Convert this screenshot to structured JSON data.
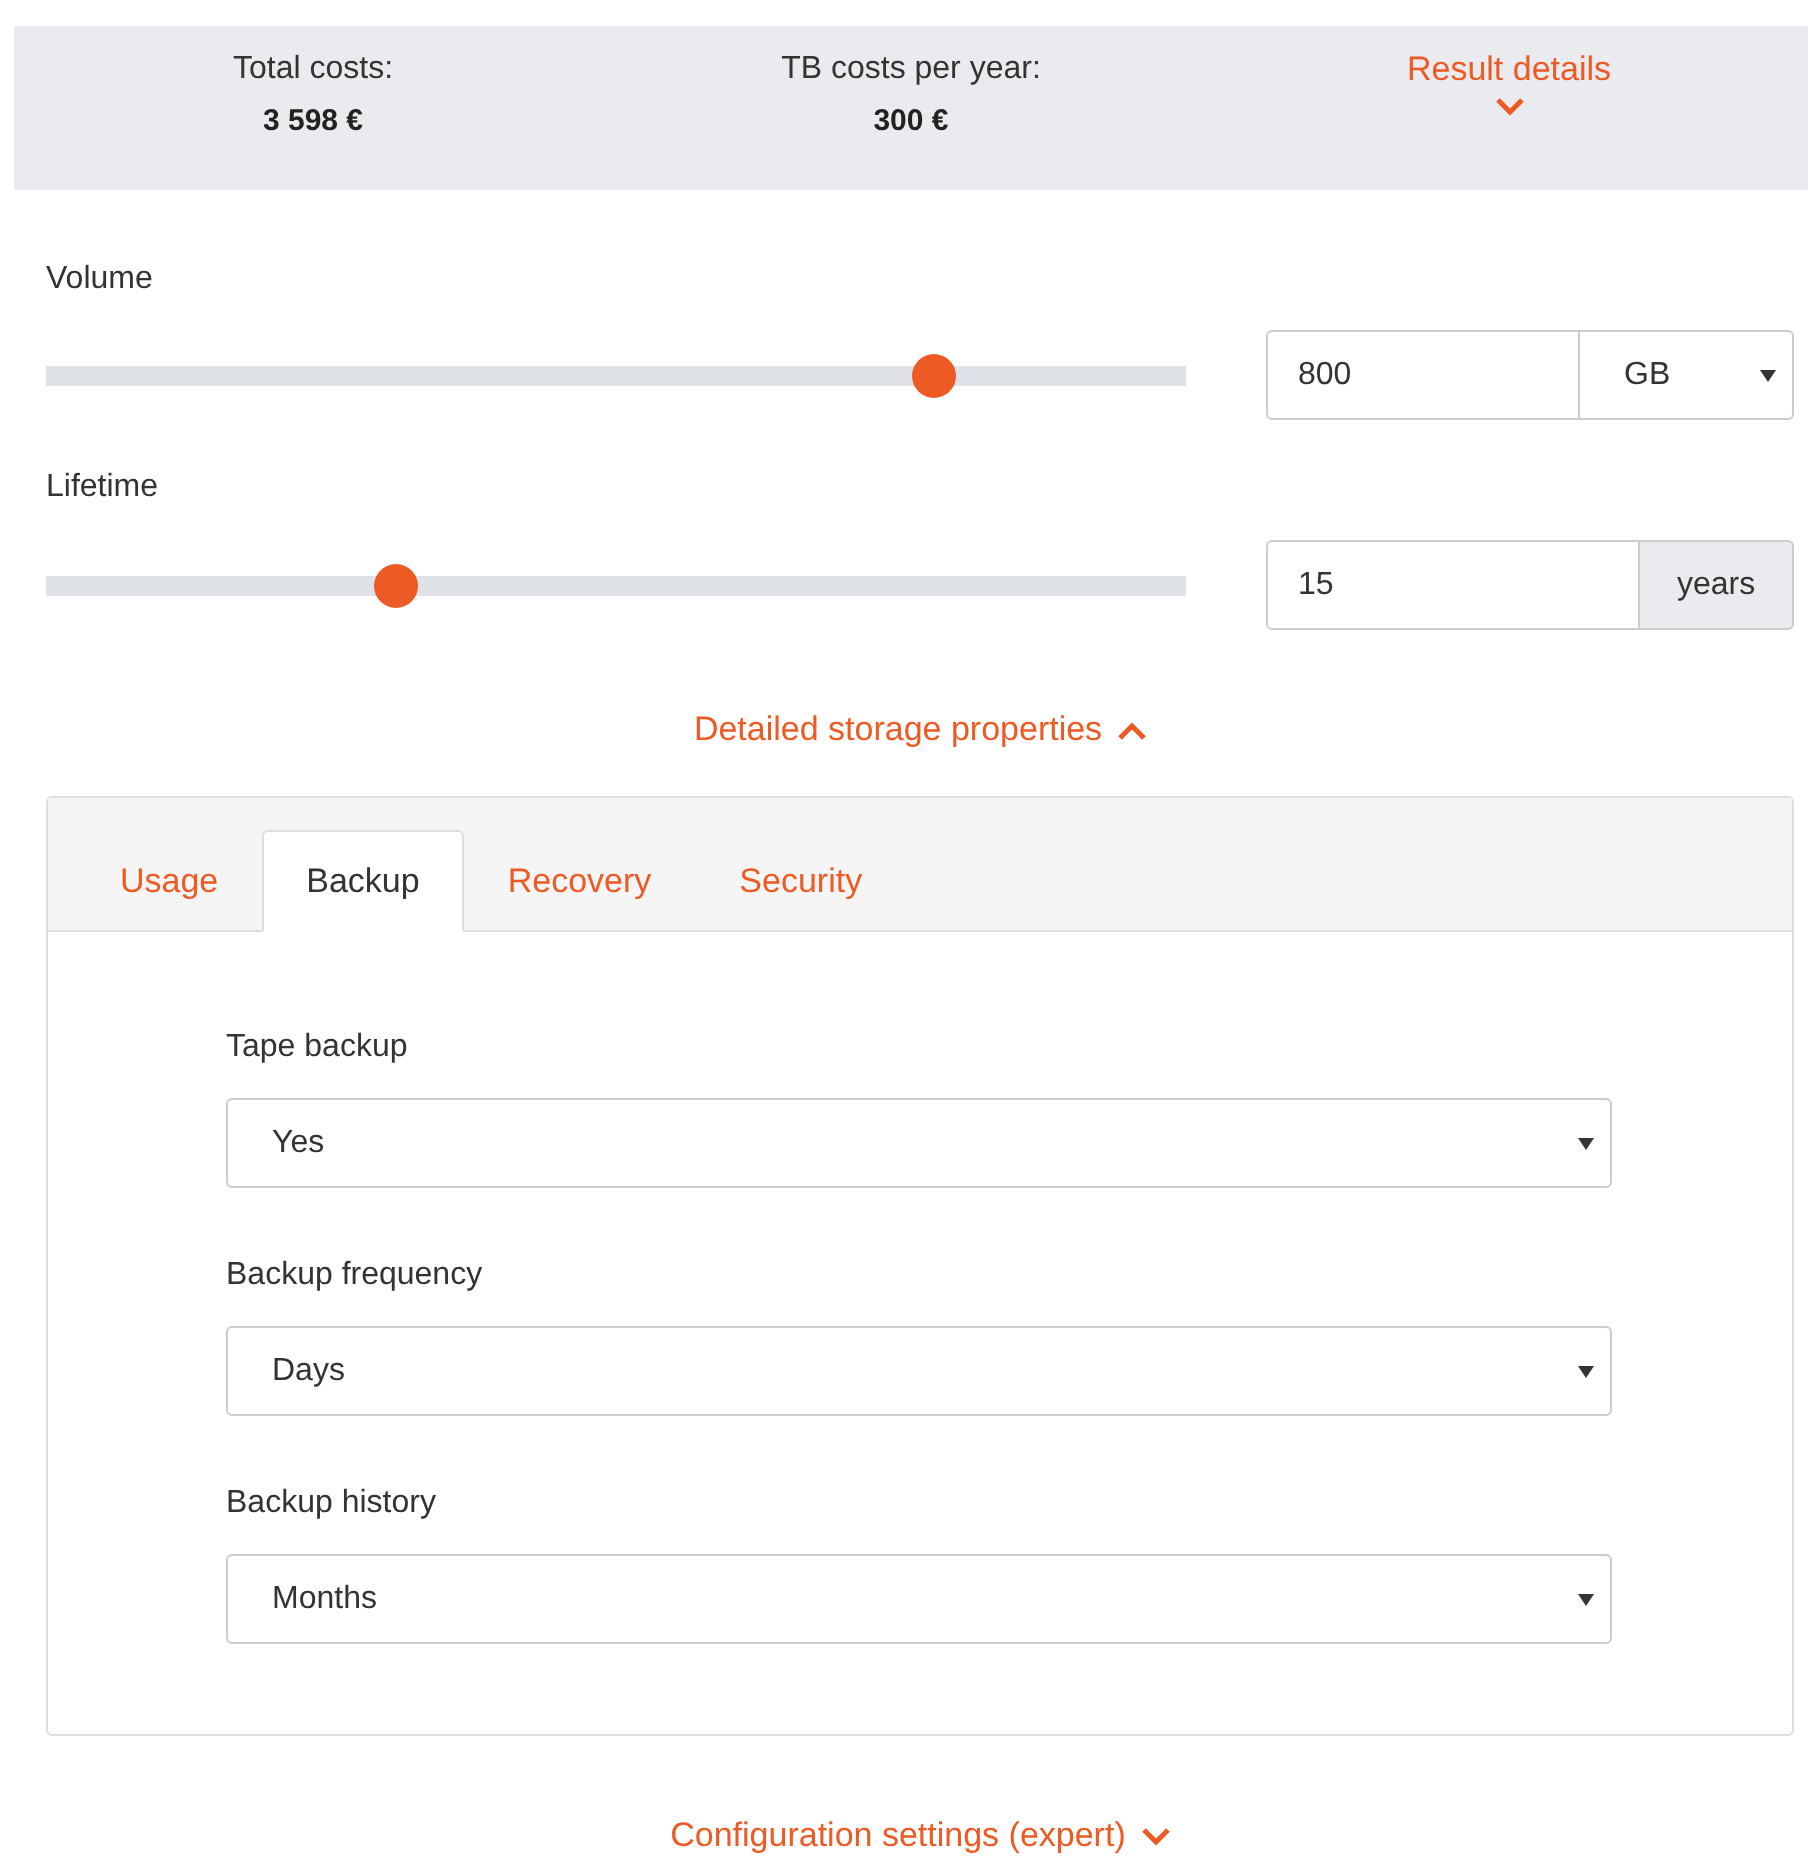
{
  "summary": [
    {
      "label": "Total costs:",
      "value": "3 598 €"
    },
    {
      "label": "TB costs per year:",
      "value": "300 €"
    }
  ],
  "result_details": {
    "label": "Result details",
    "expanded": false
  },
  "sliders": [
    {
      "label": "Volume",
      "level": 0.79,
      "value": "800",
      "unit": "GB",
      "kind": "select"
    },
    {
      "label": "Lifetime",
      "level": 0.3,
      "value": "15",
      "unit": "years",
      "kind": "addon"
    }
  ],
  "detailed_toggle": {
    "label": "Detailed storage properties",
    "expanded": true
  },
  "tabs": [
    {
      "label": "Usage",
      "selected": false
    },
    {
      "label": "Backup",
      "selected": true
    },
    {
      "label": "Recovery",
      "selected": false
    },
    {
      "label": "Security",
      "selected": false
    }
  ],
  "fields": [
    {
      "label": "Tape backup",
      "value": "Yes"
    },
    {
      "label": "Backup frequency",
      "value": "Days"
    },
    {
      "label": "Backup history",
      "value": "Months"
    }
  ],
  "config_toggle": {
    "label": "Configuration settings (expert)",
    "expanded": false
  }
}
